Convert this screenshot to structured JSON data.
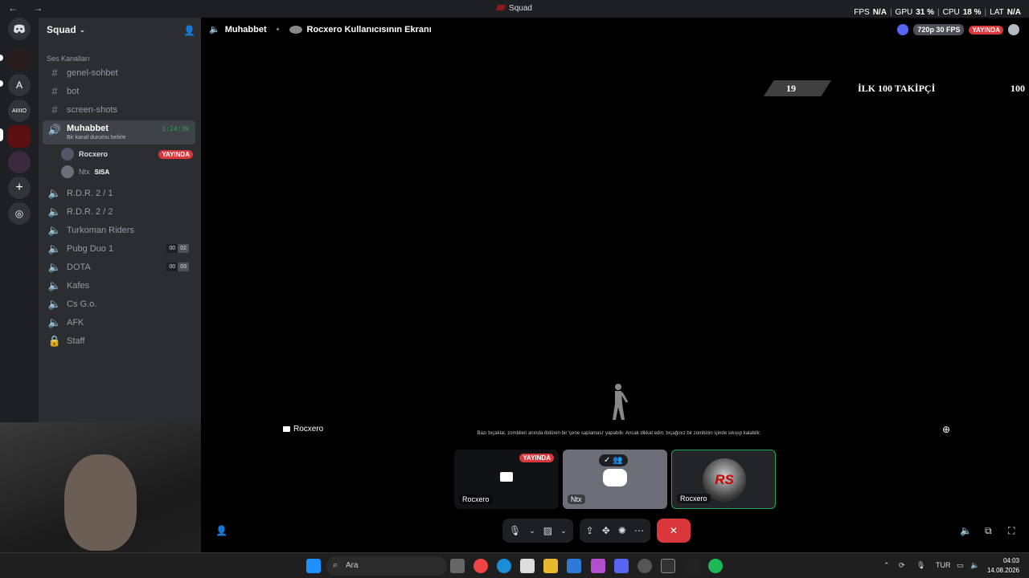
{
  "window": {
    "title": "Squad",
    "stats": {
      "fps_label": "FPS",
      "fps": "N/A",
      "gpu_label": "GPU",
      "gpu": "31 %",
      "cpu_label": "CPU",
      "cpu": "18 %",
      "lat_label": "LAT",
      "lat": "N/A"
    }
  },
  "guilds": [
    {
      "label": ""
    },
    {
      "label": "A"
    },
    {
      "label": "AIIIIO"
    },
    {
      "label": ""
    },
    {
      "label": ""
    }
  ],
  "server": {
    "name": "Squad",
    "category": "Ses Kanalları"
  },
  "channels": {
    "text": [
      "genel-sohbet",
      "bot",
      "screen-shots"
    ],
    "active": {
      "name": "Muhabbet",
      "timer": "1:24:39",
      "status": "Bir kanal durumu belirle"
    },
    "users": [
      {
        "name": "Rocxero",
        "badge": "YAYINDA"
      },
      {
        "name": "Ntx",
        "tag": "SISA"
      }
    ],
    "voice": [
      {
        "name": "R.D.R. 2 / 1"
      },
      {
        "name": "R.D.R. 2 / 2"
      },
      {
        "name": "Turkoman Riders"
      },
      {
        "name": "Pubg Duo 1",
        "a": "00",
        "b": "02"
      },
      {
        "name": "DOTA",
        "a": "00",
        "b": "03"
      },
      {
        "name": "Kafes"
      },
      {
        "name": "Cs G.o."
      },
      {
        "name": "AFK"
      },
      {
        "name": "Staff"
      }
    ]
  },
  "stage": {
    "channel": "Muhabbet",
    "screen_title": "Rocxero Kullanıcısının Ekranı",
    "quality": "720p 30 FPS",
    "live": "YAYINDA",
    "score_left": "19",
    "score_title": "İLK 100 TAKİPÇİ",
    "score_right": "100",
    "hint": "Bazı bıçaklar, zombileri anında öldüren bir 'çene saplaması' yapabilir. Ancak dikkat edin; bıçağınız bir zombinin içinde sıkışıp kalabilir.",
    "streamer": "Rocxero"
  },
  "tiles": [
    {
      "label": "Rocxero",
      "badge": "YAYINDA"
    },
    {
      "label": "Ntx"
    },
    {
      "label": "Rocxero",
      "logo": "RS"
    }
  ],
  "taskbar": {
    "search": "Ara",
    "lang": "TUR",
    "time": "04:03",
    "date": "14.08.2026"
  }
}
